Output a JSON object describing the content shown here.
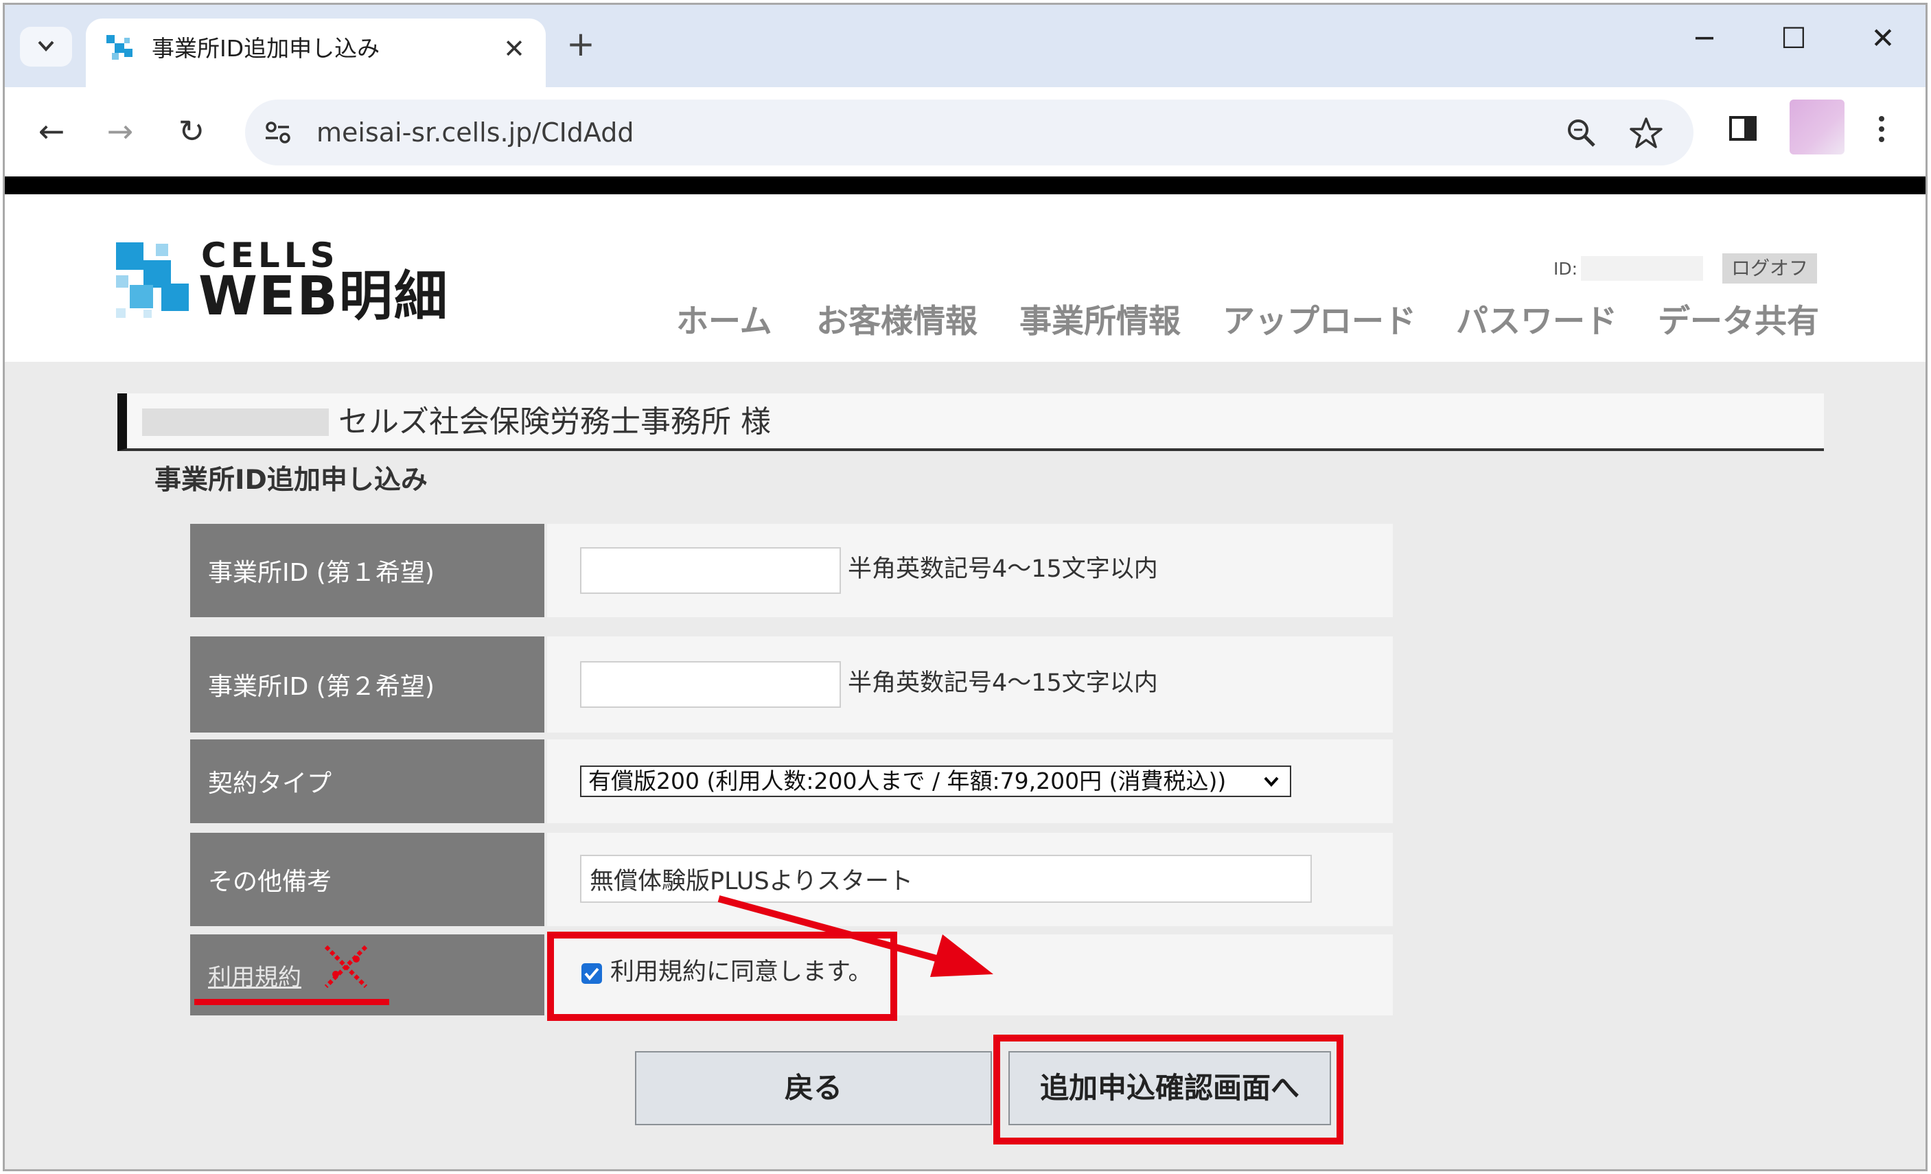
{
  "browser": {
    "tab_title": "事業所ID追加申し込み",
    "new_tab_symbol": "+",
    "close_symbol": "✕",
    "url": "meisai-sr.cells.jp/CIdAdd",
    "window_controls": {
      "minimize": "─",
      "maximize": "☐",
      "close": "✕"
    }
  },
  "header": {
    "logo_small": "CELLS",
    "logo_large": "WEB明細",
    "id_label": "ID:",
    "logoff_label": "ログオフ",
    "nav": [
      "ホーム",
      "お客様情報",
      "事業所情報",
      "アップロード",
      "パスワード",
      "データ共有"
    ]
  },
  "page": {
    "customer_name": "セルズ社会保険労務士事務所 様",
    "section_title": "事業所ID追加申し込み"
  },
  "form": {
    "rows": [
      {
        "label": "事業所ID (第１希望)",
        "value": "",
        "hint": "半角英数記号4～15文字以内"
      },
      {
        "label": "事業所ID (第２希望)",
        "value": "",
        "hint": "半角英数記号4～15文字以内"
      },
      {
        "label": "契約タイプ",
        "value": "有償版200 (利用人数:200人まで / 年額:79,200円 (消費税込))"
      },
      {
        "label": "その他備考",
        "value": "無償体験版PLUSよりスタート"
      },
      {
        "label": "利用規約",
        "annotation": "※"
      }
    ],
    "agree_label": "利用規約に同意します。",
    "agree_checked": true,
    "back_button": "戻る",
    "confirm_button": "追加申込確認画面へ"
  },
  "colors": {
    "highlight": "#e60012",
    "label_bg": "#7b7b7b",
    "logo_blue": "#1e9bd7"
  }
}
